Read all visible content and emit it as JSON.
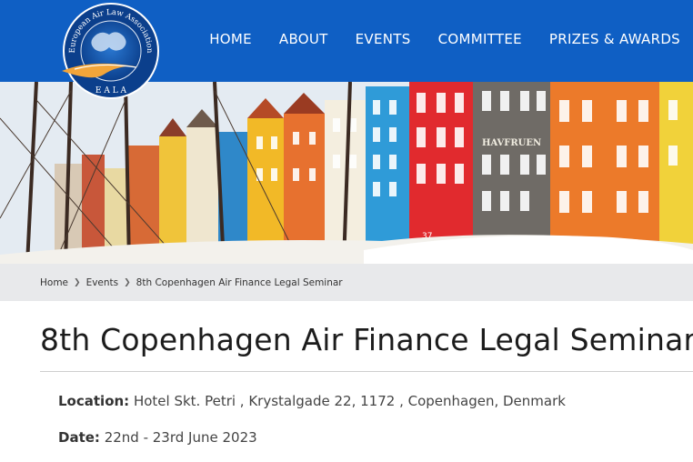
{
  "logo": {
    "ring_text": "European Air Law Association",
    "abbrev": "E A L A"
  },
  "nav": {
    "items": [
      "HOME",
      "ABOUT",
      "EVENTS",
      "COMMITTEE",
      "PRIZES & AWARDS"
    ]
  },
  "hero": {
    "sign_text": "HAVFRUEN",
    "house_number": "37"
  },
  "breadcrumb": {
    "home": "Home",
    "events": "Events",
    "current": "8th Copenhagen Air Finance Legal Seminar"
  },
  "page": {
    "title": "8th Copenhagen Air Finance Legal Seminar",
    "location_label": "Location:",
    "location_value": "Hotel Skt. Petri , Krystalgade 22, 1172 , Copenhagen, Denmark",
    "date_label": "Date:",
    "date_value": "22nd - 23rd June 2023"
  },
  "colors": {
    "header": "#0f5fc4",
    "breadcrumb_bg": "#e8e9eb"
  }
}
